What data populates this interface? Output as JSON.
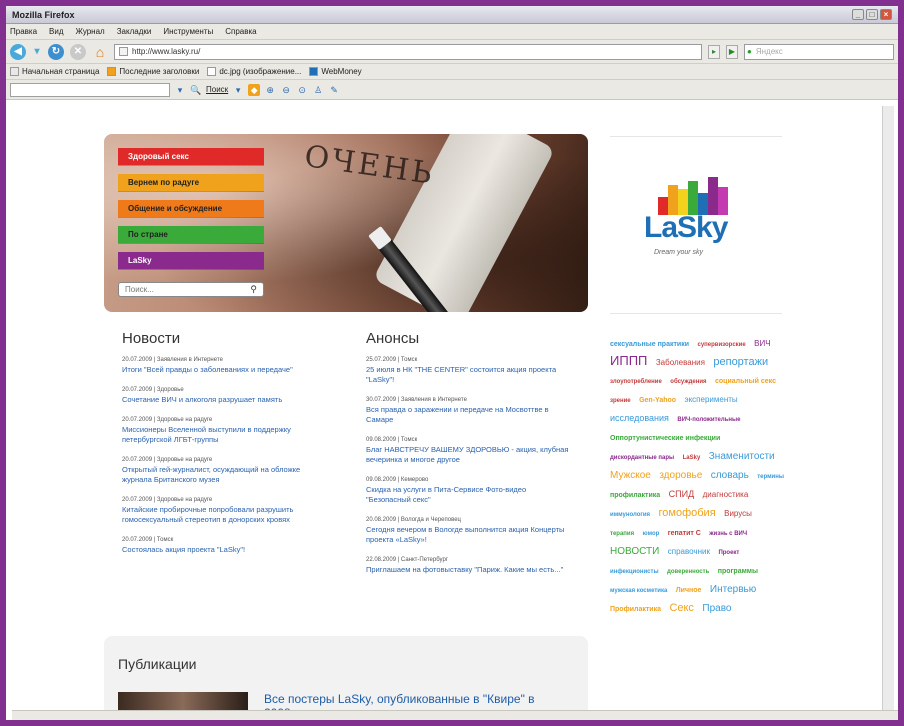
{
  "browser": {
    "title": "Mozilla Firefox",
    "menu": [
      "Правка",
      "Вид",
      "Журнал",
      "Закладки",
      "Инструменты",
      "Справка"
    ],
    "url": "http://www.lasky.ru/",
    "search_placeholder": "Яндекс",
    "bookmarks": [
      "Начальная страница",
      "Последние заголовки",
      "dc.jpg (изображение...",
      "WebMoney"
    ],
    "toolbar_search_label": "Поиск"
  },
  "hero": {
    "menu": [
      {
        "label": "Здоровый секс",
        "color": "#e02a2a"
      },
      {
        "label": "Вернем по радуге",
        "color": "#f0a21c"
      },
      {
        "label": "Общение и обсуждение",
        "color": "#ee7a1a"
      },
      {
        "label": "По стране",
        "color": "#3aaa3a"
      },
      {
        "label": "LaSky",
        "color": "#8a2a8c"
      }
    ],
    "search_placeholder": "Поиск...",
    "body_writing": "ОЧЕНЬ"
  },
  "logo": {
    "text": "LaSky",
    "tagline": "Dream your sky",
    "bar_colors": [
      "#e02a2a",
      "#f0a21c",
      "#f2d21c",
      "#3aaa3a",
      "#1e6fb6",
      "#8a2a8c",
      "#c43ab0"
    ]
  },
  "news": {
    "title": "Новости",
    "items": [
      {
        "meta": "20.07.2009 | Заявления в Интернете",
        "link": "Итоги \"Всей правды о заболеваниях и передаче\""
      },
      {
        "meta": "20.07.2009 | Здоровье",
        "link": "Сочетание ВИЧ и алкоголя разрушает память"
      },
      {
        "meta": "20.07.2009 | Здоровье на радуге",
        "link": "Миссионеры Вселенной выступили в поддержку петербургской ЛГБТ-группы"
      },
      {
        "meta": "20.07.2009 | Здоровье на радуге",
        "link": "Открытый гей-журналист, осуждающий на обложке журнала Британского музея"
      },
      {
        "meta": "20.07.2009 | Здоровье на радуге",
        "link": "Китайские пробирочные попробовали разрушить гомосексуальный стереотип в донорских кровях"
      },
      {
        "meta": "20.07.2009 | Томск",
        "link": "Состоялась акция проекта \"LaSky\"!"
      }
    ]
  },
  "announcements": {
    "title": "Анонсы",
    "items": [
      {
        "meta": "25.07.2009 | Томск",
        "link": "25 июля в НК \"THE CENTER\" состоится акция проекта \"LaSky\"!"
      },
      {
        "meta": "30.07.2009 | Заявления в Интернете",
        "link": "Вся правда о заражении и передаче на Мосвоттве в Самаре"
      },
      {
        "meta": "09.08.2009 | Томск",
        "link": "Благ НАВСТРЕЧУ ВАШЕМУ ЗДОРОВЬЮ - акция, клубная вечеринка и многое другое"
      },
      {
        "meta": "09.08.2009 | Кемерово",
        "link": "Скидка на услуги в Пита-Сервисе Фото-видео \"Безопасный секс\""
      },
      {
        "meta": "20.08.2009 | Вологда и Череповец",
        "link": "Сегодня вечером в Вологде выполнится акция Концерты проекта «LaSky»!"
      },
      {
        "meta": "22.08.2009 | Санкт-Петербург",
        "link": "Приглашаем на фотовыставку \"Париж. Какие мы есть...\""
      }
    ]
  },
  "tags": [
    {
      "text": "сексуальные практики",
      "color": "#3a9ad8",
      "size": 7
    },
    {
      "text": "супервизорские",
      "color": "#c43a3a",
      "size": 6
    },
    {
      "text": "ВИЧ",
      "color": "#8a2a8c",
      "size": 8
    },
    {
      "text": "ИППП",
      "color": "#8a2a8c",
      "size": 13
    },
    {
      "text": "Заболевания",
      "color": "#c43a3a",
      "size": 8
    },
    {
      "text": "репортажи",
      "color": "#3a9ad8",
      "size": 11
    },
    {
      "text": "злоупотребление",
      "color": "#c43a3a",
      "size": 6
    },
    {
      "text": "обсуждения",
      "color": "#c43a3a",
      "size": 6
    },
    {
      "text": "социальный секс",
      "color": "#f0a21c",
      "size": 7
    },
    {
      "text": "зрение",
      "color": "#c43a3a",
      "size": 6
    },
    {
      "text": "Gen-Yahoo",
      "color": "#f0a21c",
      "size": 7
    },
    {
      "text": "эксперименты",
      "color": "#3a9ad8",
      "size": 8
    },
    {
      "text": "исследования",
      "color": "#3a9ad8",
      "size": 9
    },
    {
      "text": "ВИЧ-положительные",
      "color": "#8a2a8c",
      "size": 6
    },
    {
      "text": "Оппортунистические инфекции",
      "color": "#3aaa3a",
      "size": 7
    },
    {
      "text": "дискордантные пары",
      "color": "#8a2a8c",
      "size": 6
    },
    {
      "text": "LaSky",
      "color": "#c43a3a",
      "size": 6
    },
    {
      "text": "Знаменитости",
      "color": "#3a9ad8",
      "size": 10
    },
    {
      "text": "Мужское",
      "color": "#f0a21c",
      "size": 10
    },
    {
      "text": "здоровье",
      "color": "#f0a21c",
      "size": 10
    },
    {
      "text": "словарь",
      "color": "#3a9ad8",
      "size": 10
    },
    {
      "text": "термины",
      "color": "#3a9ad8",
      "size": 6
    },
    {
      "text": "профилактика",
      "color": "#3aaa3a",
      "size": 7
    },
    {
      "text": "СПИД",
      "color": "#c43a3a",
      "size": 9
    },
    {
      "text": "диагностика",
      "color": "#c43a3a",
      "size": 8
    },
    {
      "text": "иммунология",
      "color": "#3a9ad8",
      "size": 6
    },
    {
      "text": "гомофобия",
      "color": "#f0a21c",
      "size": 11
    },
    {
      "text": "Вирусы",
      "color": "#c43a3a",
      "size": 8
    },
    {
      "text": "терапия",
      "color": "#3aaa3a",
      "size": 6
    },
    {
      "text": "юмор",
      "color": "#3a9ad8",
      "size": 6
    },
    {
      "text": "гепатит С",
      "color": "#c43a3a",
      "size": 7
    },
    {
      "text": "жизнь с ВИЧ",
      "color": "#8a2a8c",
      "size": 6
    },
    {
      "text": "НОВОСТИ",
      "color": "#3aaa3a",
      "size": 10
    },
    {
      "text": "справочник",
      "color": "#3a9ad8",
      "size": 8
    },
    {
      "text": "Проект",
      "color": "#8a2a8c",
      "size": 6
    },
    {
      "text": "инфекционисты",
      "color": "#3a9ad8",
      "size": 6
    },
    {
      "text": "доверенность",
      "color": "#3aaa3a",
      "size": 6
    },
    {
      "text": "программы",
      "color": "#3aaa3a",
      "size": 7
    },
    {
      "text": "мужская косметика",
      "color": "#3a9ad8",
      "size": 6
    },
    {
      "text": "Личное",
      "color": "#f0a21c",
      "size": 7
    },
    {
      "text": "Интервью",
      "color": "#3a9ad8",
      "size": 10
    },
    {
      "text": "Профилактика",
      "color": "#f0a21c",
      "size": 7
    },
    {
      "text": "Секс",
      "color": "#f0a21c",
      "size": 11
    },
    {
      "text": "Право",
      "color": "#3a9ad8",
      "size": 10
    }
  ],
  "publications": {
    "title": "Публикации",
    "item_title": "Все постеры LaSky, опубликованные в \"Квире\" в 2008..."
  }
}
